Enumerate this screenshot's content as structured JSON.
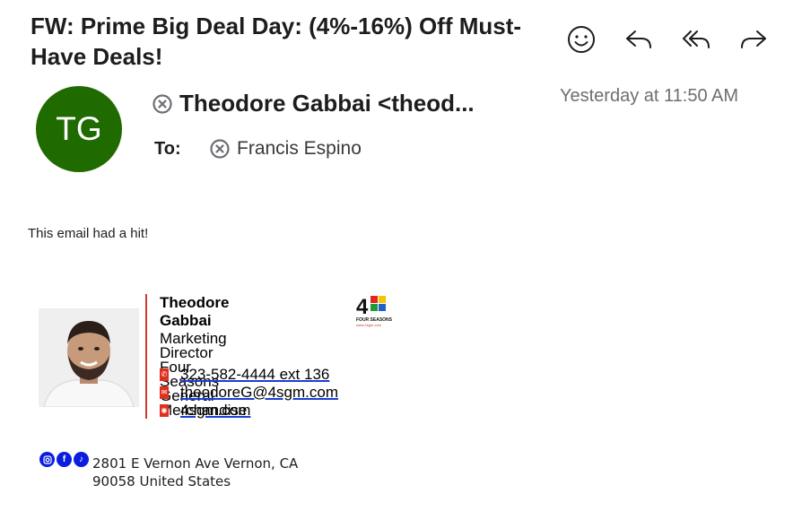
{
  "email": {
    "subject": "FW: Prime Big Deal Day: (4%-16%) Off Must-Have Deals!",
    "sender": "Theodore Gabbai <theod...",
    "avatar_initials": "TG",
    "avatar_color": "#1f6b00",
    "date": "Yesterday at 11:50 AM",
    "to_label": "To:",
    "recipient": "Francis Espino",
    "body_intro": "This email had a hit!"
  },
  "toolbar": {
    "actions": [
      {
        "name": "emoji-reaction",
        "icon": "smiley-icon"
      },
      {
        "name": "reply",
        "icon": "reply-icon"
      },
      {
        "name": "reply-all",
        "icon": "reply-all-icon"
      },
      {
        "name": "forward",
        "icon": "forward-icon"
      }
    ]
  },
  "signature": {
    "name": "Theodore Gabbai",
    "title": "Marketing Director",
    "company_line1": "Four Seasons",
    "company_line2": "General Merchandise",
    "phone": "323-582-4444 ext 136",
    "email": "theodoreG@4sgm.com",
    "website": "4sgm.com",
    "logo_text": "FOUR SEASONS",
    "logo_url": "www.4sgm.com",
    "address_line1": "2801 E Vernon Ave Vernon, CA",
    "address_line2": "90058 United States",
    "accent_color": "#d13a2a",
    "social_icons": [
      "instagram-icon",
      "facebook-icon",
      "tiktok-icon"
    ]
  }
}
